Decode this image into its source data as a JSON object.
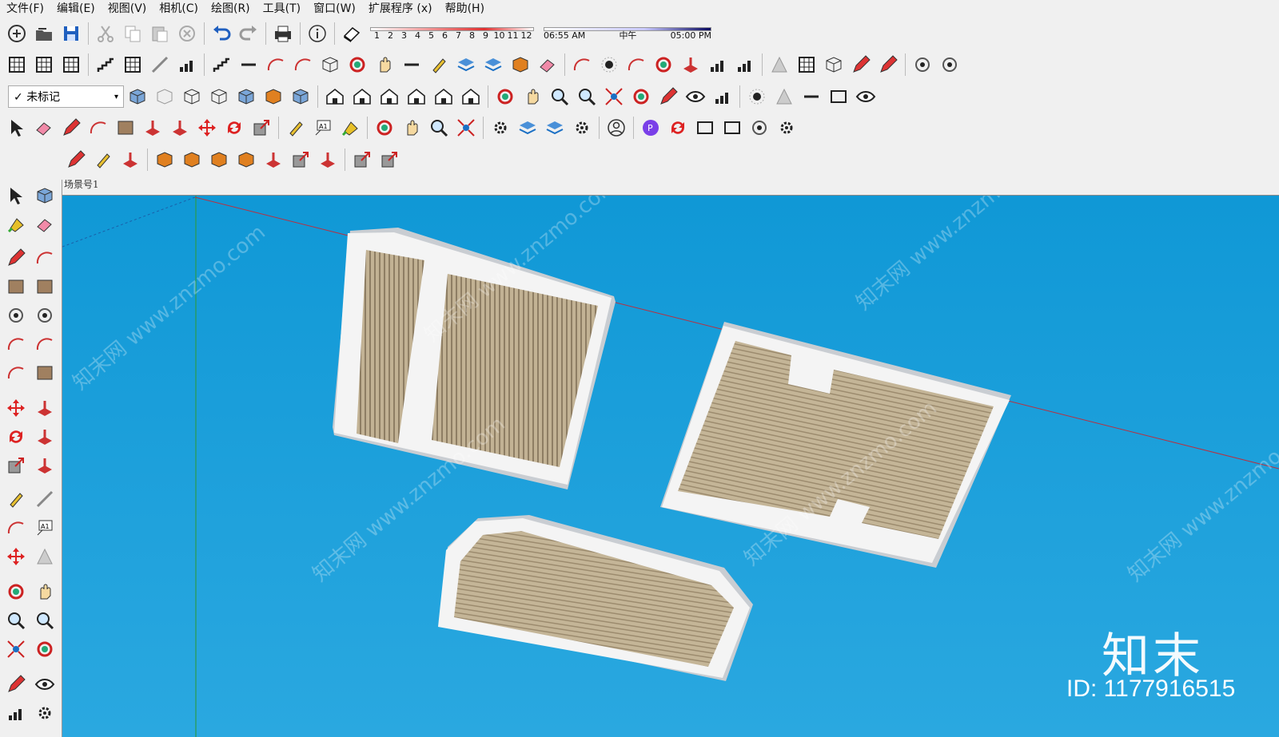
{
  "menu": [
    "文件(F)",
    "编辑(E)",
    "视图(V)",
    "相机(C)",
    "绘图(R)",
    "工具(T)",
    "窗口(W)",
    "扩展程序 (x)",
    "帮助(H)"
  ],
  "shadow": {
    "months": [
      "1",
      "2",
      "3",
      "4",
      "5",
      "6",
      "7",
      "8",
      "9",
      "10",
      "11",
      "12"
    ],
    "time_start": "06:55 AM",
    "noon": "中午",
    "time_end": "05:00 PM"
  },
  "tag_select": {
    "value": "未标记",
    "check": "✓"
  },
  "scene_tab": "场景号1",
  "watermark": {
    "text": "知末网 www.znzmo.com",
    "logo": "知末",
    "id": "ID: 1177916515"
  },
  "colors": {
    "sky": "#1aa0da",
    "panel": "#f4f4f4",
    "wood": "#b9a88a",
    "accent": "#2b6fd6",
    "red_axis": "#c0303a",
    "green_axis": "#2c9b4a"
  },
  "toolbar_icons": {
    "row1": [
      "new-icon",
      "open-icon",
      "save-icon",
      "cut-icon",
      "copy-icon",
      "paste-icon",
      "erase-icon",
      "undo-icon",
      "redo-icon",
      "print-icon",
      "info-icon",
      "shadow-toggle-icon"
    ],
    "row2": [
      "grid-icon",
      "ring-icon",
      "model-icon"
    ],
    "row3": [
      "box-icon",
      "xray-icon",
      "wireframe-icon",
      "hidden-line-icon",
      "shaded-icon",
      "textured-icon",
      "monochrome-icon",
      "iso-icon",
      "top-icon",
      "front-icon",
      "right-icon",
      "back-icon",
      "left-icon"
    ],
    "row4": [
      "select-icon",
      "eraser-icon",
      "pencil-icon",
      "arc-icon",
      "rect-icon",
      "push-pull-icon",
      "follow-me-icon",
      "move-icon",
      "rotate-icon",
      "scale-icon",
      "tape-icon",
      "text-icon",
      "paint-icon",
      "orbit-icon",
      "pan-icon",
      "zoom-icon",
      "zoom-extents-icon"
    ]
  }
}
